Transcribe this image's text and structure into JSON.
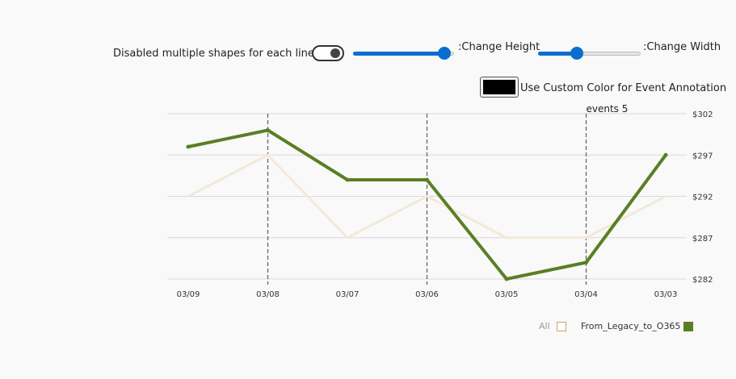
{
  "controls": {
    "shapes_toggle_label": "Disabled multiple shapes for each line",
    "height_label": ":Change Height",
    "height_value": 0.9,
    "width_label": ":Change Width",
    "width_value": 0.38,
    "color_label": "Use Custom Color for Event Annotation",
    "annotation_color": "#000000"
  },
  "legend": {
    "all_label": "All",
    "series_label": "From_Legacy_to_O365",
    "series_color": "#5a7f24",
    "all_color": "#c8a86a"
  },
  "chart_data": {
    "type": "line",
    "categories": [
      "03/09",
      "03/08",
      "03/07",
      "03/06",
      "03/05",
      "03/04",
      "03/03"
    ],
    "series": [
      {
        "name": "From_Legacy_to_O365",
        "values": [
          298,
          300,
          294,
          294,
          282,
          284,
          297
        ],
        "color": "#5a7f24"
      },
      {
        "values": [
          292,
          297,
          287,
          292,
          287,
          287,
          292
        ],
        "color": "#f2ead8"
      }
    ],
    "ylim": [
      282,
      302
    ],
    "yticks": [
      "$302",
      "$297",
      "$292",
      "$287",
      "$282"
    ],
    "ytick_values": [
      302,
      297,
      292,
      287,
      282
    ],
    "events": [
      {
        "at": "03/08",
        "label": ""
      },
      {
        "at": "03/06",
        "label": ""
      },
      {
        "at": "03/04",
        "label": "events 5"
      }
    ],
    "grid": true
  }
}
